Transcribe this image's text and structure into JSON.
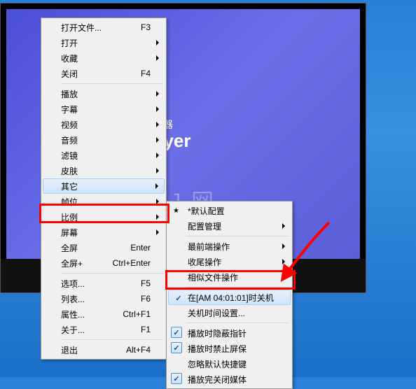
{
  "player": {
    "subtitle": "放器",
    "title": "ayer",
    "watermark": "XJ·网"
  },
  "menu1": [
    {
      "label": "打开文件...",
      "shortcut": "F3"
    },
    {
      "label": "打开",
      "arrow": true
    },
    {
      "label": "收藏",
      "arrow": true
    },
    {
      "label": "关闭",
      "shortcut": "F4"
    },
    {
      "sep": true
    },
    {
      "label": "播放",
      "arrow": true
    },
    {
      "label": "字幕",
      "arrow": true
    },
    {
      "label": "视频",
      "arrow": true
    },
    {
      "label": "音频",
      "arrow": true
    },
    {
      "label": "滤镜",
      "arrow": true
    },
    {
      "label": "皮肤",
      "arrow": true
    },
    {
      "label": "其它",
      "arrow": true,
      "hover": true
    },
    {
      "label": "帧位",
      "arrow": true
    },
    {
      "label": "比例",
      "arrow": true
    },
    {
      "label": "屏幕",
      "arrow": true
    },
    {
      "label": "全屏",
      "shortcut": "Enter"
    },
    {
      "label": "全屏+",
      "shortcut": "Ctrl+Enter"
    },
    {
      "sep": true
    },
    {
      "label": "选项...",
      "shortcut": "F5"
    },
    {
      "label": "列表...",
      "shortcut": "F6"
    },
    {
      "label": "属性...",
      "shortcut": "Ctrl+F1"
    },
    {
      "label": "关于...",
      "shortcut": "F1"
    },
    {
      "sep": true
    },
    {
      "label": "退出",
      "shortcut": "Alt+F4"
    }
  ],
  "menu2": [
    {
      "label": "*默认配置",
      "star": true
    },
    {
      "label": "配置管理",
      "arrow": true
    },
    {
      "sep": true
    },
    {
      "label": "最前端操作",
      "arrow": true
    },
    {
      "label": "收尾操作",
      "arrow": true
    },
    {
      "label": "相似文件操作",
      "arrow": true
    },
    {
      "sep": true
    },
    {
      "label": "在[AM 04:01:01]时关机",
      "check": true,
      "hover": true
    },
    {
      "label": "关机时间设置..."
    },
    {
      "sep": true
    },
    {
      "label": "播放时隐蔽指针",
      "check": true
    },
    {
      "label": "播放时禁止屏保",
      "check": true
    },
    {
      "label": "忽略默认快捷键"
    },
    {
      "label": "播放完关闭媒体",
      "check": true
    }
  ]
}
